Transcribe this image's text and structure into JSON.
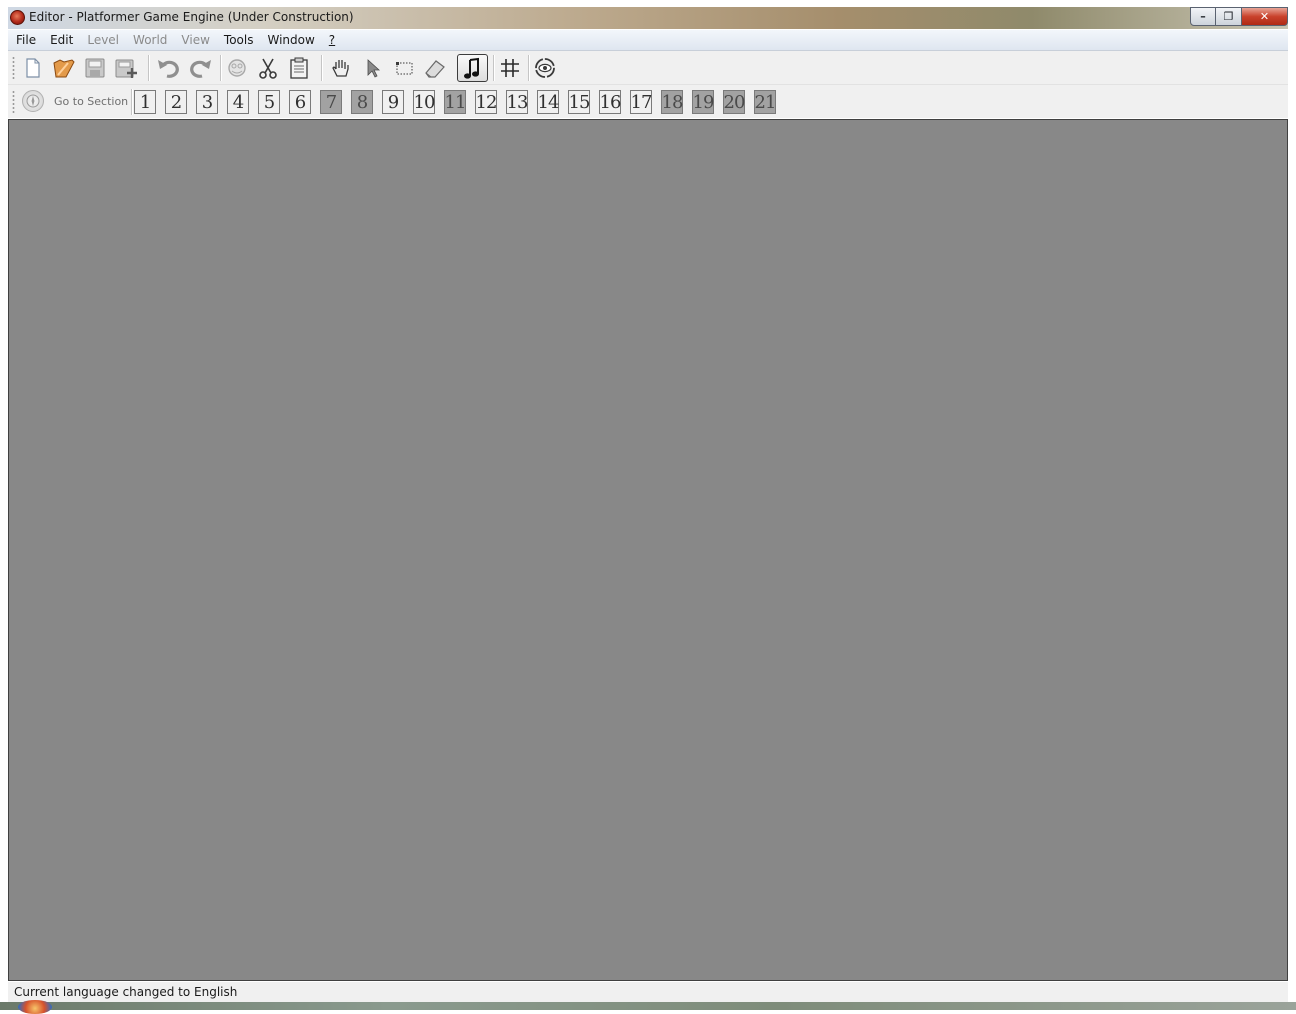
{
  "window": {
    "title": "Editor - Platformer Game Engine (Under Construction)",
    "minimize_label": "–",
    "maximize_label": "❐",
    "close_label": "✕"
  },
  "menu": [
    {
      "label": "File",
      "enabled": true
    },
    {
      "label": "Edit",
      "enabled": true
    },
    {
      "label": "Level",
      "enabled": false
    },
    {
      "label": "World",
      "enabled": false
    },
    {
      "label": "View",
      "enabled": false
    },
    {
      "label": "Tools",
      "enabled": true
    },
    {
      "label": "Window",
      "enabled": true
    },
    {
      "label": "?",
      "enabled": true
    }
  ],
  "toolbar": {
    "buttons": [
      {
        "name": "new-file",
        "icon": "new-file-icon"
      },
      {
        "name": "open-file",
        "icon": "folder-open-icon"
      },
      {
        "name": "save",
        "icon": "save-icon"
      },
      {
        "name": "save-as",
        "icon": "save-plus-icon"
      },
      {
        "name": "undo",
        "icon": "undo-icon"
      },
      {
        "name": "redo",
        "icon": "redo-icon"
      },
      {
        "name": "copy",
        "icon": "copy-icon"
      },
      {
        "name": "cut",
        "icon": "scissors-icon"
      },
      {
        "name": "paste",
        "icon": "clipboard-icon"
      },
      {
        "name": "hand",
        "icon": "hand-icon"
      },
      {
        "name": "select",
        "icon": "arrow-pointer-icon"
      },
      {
        "name": "resize",
        "icon": "dotted-rectangle-icon"
      },
      {
        "name": "eraser",
        "icon": "eraser-icon"
      },
      {
        "name": "music",
        "icon": "music-note-icon",
        "active": true
      },
      {
        "name": "grid",
        "icon": "grid-icon"
      },
      {
        "name": "animate",
        "icon": "eye-cycle-icon"
      }
    ]
  },
  "sections": {
    "label": "Go to Section",
    "icon": "compass-icon",
    "items": [
      {
        "label": "1",
        "shaded": false
      },
      {
        "label": "2",
        "shaded": false
      },
      {
        "label": "3",
        "shaded": false
      },
      {
        "label": "4",
        "shaded": false
      },
      {
        "label": "5",
        "shaded": false
      },
      {
        "label": "6",
        "shaded": false
      },
      {
        "label": "7",
        "shaded": true
      },
      {
        "label": "8",
        "shaded": true
      },
      {
        "label": "9",
        "shaded": false
      },
      {
        "label": "10",
        "shaded": false
      },
      {
        "label": "11",
        "shaded": true
      },
      {
        "label": "12",
        "shaded": false
      },
      {
        "label": "13",
        "shaded": false
      },
      {
        "label": "14",
        "shaded": false
      },
      {
        "label": "15",
        "shaded": false
      },
      {
        "label": "16",
        "shaded": false
      },
      {
        "label": "17",
        "shaded": false
      },
      {
        "label": "18",
        "shaded": true
      },
      {
        "label": "19",
        "shaded": true
      },
      {
        "label": "20",
        "shaded": true
      },
      {
        "label": "21",
        "shaded": true
      }
    ]
  },
  "status": {
    "message": "Current language changed to English"
  },
  "colors": {
    "canvas": "#888888",
    "toolbar_bg": "#f0f0f0",
    "section_shaded": "#a2a2a2"
  }
}
